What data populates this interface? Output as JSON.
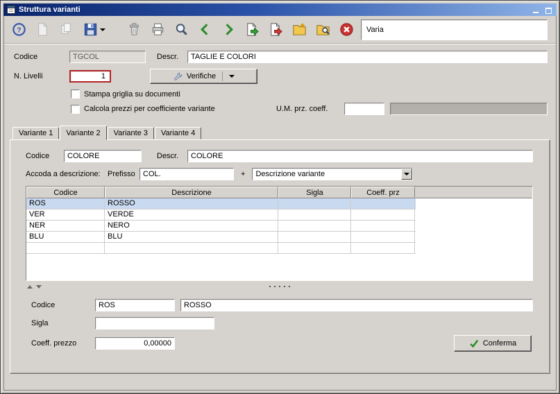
{
  "window": {
    "title": "Struttura varianti"
  },
  "toolbar": {
    "icons": [
      "help",
      "new-document-disabled",
      "copy-document-disabled",
      "save",
      "save-menu",
      "delete",
      "print",
      "search",
      "previous",
      "next",
      "export-document",
      "exit-document",
      "folder-add",
      "folder-search",
      "close"
    ],
    "context_field": "Varia"
  },
  "form": {
    "codice_label": "Codice",
    "codice_value": "TGCOL",
    "descr_label": "Descr.",
    "descr_value": "TAGLIE E COLORI",
    "livelli_label": "N. Livelli",
    "livelli_value": "1",
    "verifiche_button": "Verifiche",
    "check_stampa": "Stampa griglia su documenti",
    "check_calcola": "Calcola prezzi per coefficiente variante",
    "um_label": "U.M. prz. coeff.",
    "um_value": "",
    "um_descr_value": ""
  },
  "tabs": [
    {
      "label": "Variante 1"
    },
    {
      "label": "Variante 2"
    },
    {
      "label": "Variante 3"
    },
    {
      "label": "Variante 4"
    }
  ],
  "active_tab": "Variante 2",
  "variant": {
    "codice_label": "Codice",
    "codice_value": "COLORE",
    "descr_label": "Descr.",
    "descr_value": "COLORE",
    "accoda_label": "Accoda a descrizione:",
    "prefisso_label": "Prefisso",
    "prefisso_value": "COL.",
    "plus_sign": "+",
    "descrizione_combo": "Descrizione variante"
  },
  "table": {
    "columns": [
      "Codice",
      "Descrizione",
      "Sigla",
      "Coeff. prz"
    ],
    "rows": [
      {
        "codice": "ROS",
        "descrizione": "ROSSO",
        "sigla": "",
        "coeff_prz": ""
      },
      {
        "codice": "VER",
        "descrizione": "VERDE",
        "sigla": "",
        "coeff_prz": ""
      },
      {
        "codice": "NER",
        "descrizione": "NERO",
        "sigla": "",
        "coeff_prz": ""
      },
      {
        "codice": "BLU",
        "descrizione": "BLU",
        "sigla": "",
        "coeff_prz": ""
      }
    ],
    "selected_row": "ROS"
  },
  "detail": {
    "codice_label": "Codice",
    "codice_value": "ROS",
    "descr_value": "ROSSO",
    "sigla_label": "Sigla",
    "sigla_value": "",
    "coeff_label": "Coeff. prezzo",
    "coeff_value": "0,00000",
    "conferma_button": "Conferma"
  },
  "colors": {
    "titlebar_start": "#0a246a",
    "titlebar_end": "#8fb4e8",
    "window_bg": "#d6d3ce",
    "selected_row_bg": "#c9daf0",
    "error_border": "#b22222",
    "confirm_green": "#2a8f2a",
    "close_red": "#c83232"
  }
}
